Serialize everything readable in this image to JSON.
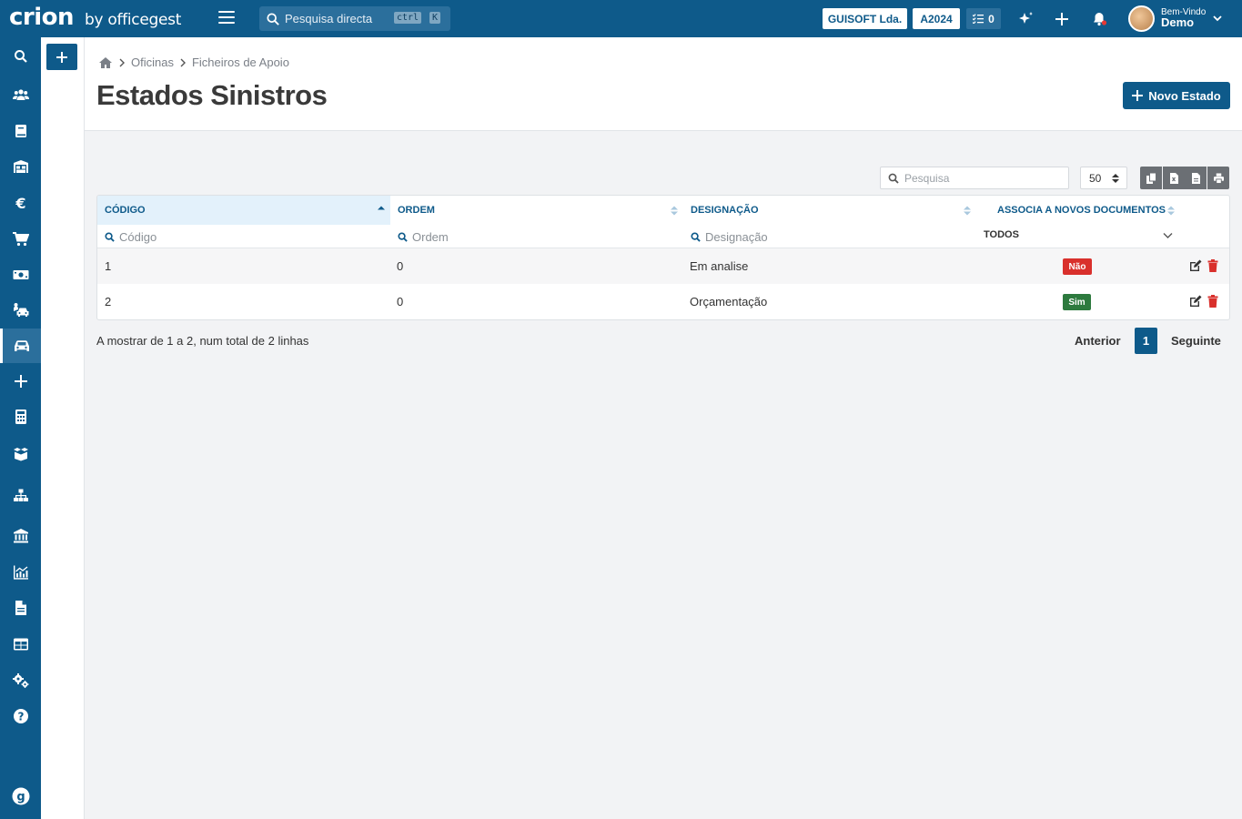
{
  "app": {
    "brand": "crion",
    "brand_by": "by officegest",
    "search_placeholder": "Pesquisa directa",
    "kbd_ctrl": "ctrl",
    "kbd_k": "K",
    "company": "GUISOFT Lda.",
    "year": "A2024",
    "tasks_count": "0",
    "welcome": "Bem-Vindo",
    "user_name": "Demo"
  },
  "breadcrumb": [
    "Oficinas",
    "Ficheiros de Apoio"
  ],
  "page": {
    "title": "Estados Sinistros",
    "new_button": "Novo Estado"
  },
  "toolbar": {
    "search_placeholder": "Pesquisa",
    "page_size": "50"
  },
  "table": {
    "columns": [
      "Código",
      "Ordem",
      "Designação",
      "Associa a novos documentos"
    ],
    "filters": [
      "Código",
      "Ordem",
      "Designação",
      "TODOS"
    ],
    "rows": [
      {
        "codigo": "1",
        "ordem": "0",
        "designacao": "Em analise",
        "associa": "Não",
        "associa_color": "#d9302c"
      },
      {
        "codigo": "2",
        "ordem": "0",
        "designacao": "Orçamentação",
        "associa": "Sim",
        "associa_color": "#2d7a3e"
      }
    ]
  },
  "pagination": {
    "info": "A mostrar de 1 a 2, num total de 2 linhas",
    "previous": "Anterior",
    "current": "1",
    "next": "Seguinte"
  },
  "colors": {
    "primary": "#0e5a8a",
    "no_badge": "#d9302c",
    "yes_badge": "#2d7a3e"
  }
}
